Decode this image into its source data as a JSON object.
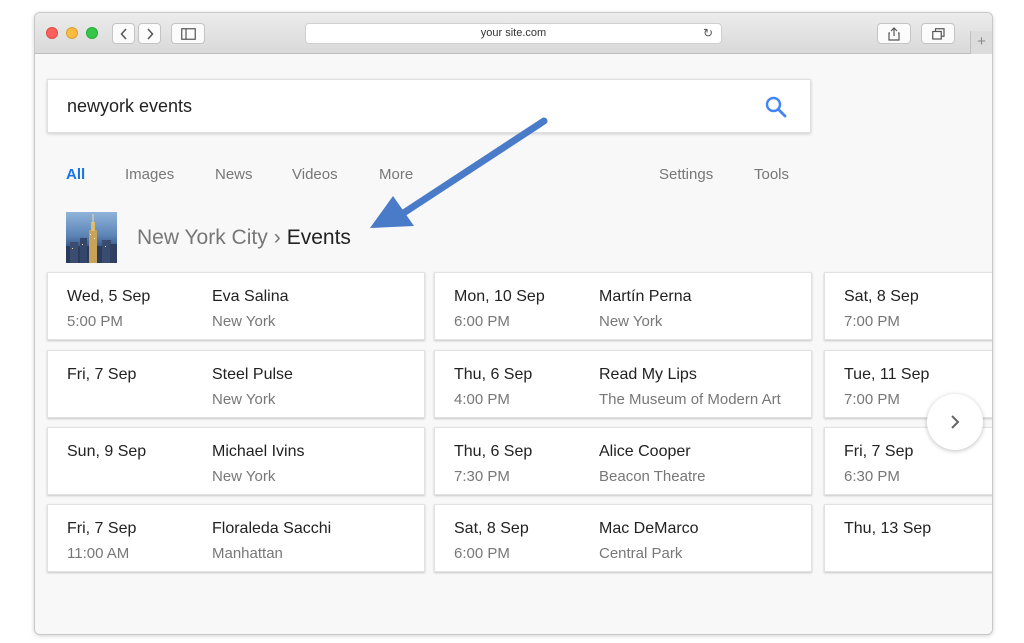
{
  "browser": {
    "url": "your site.com"
  },
  "search": {
    "query": "newyork events"
  },
  "tabs": [
    {
      "label": "All",
      "active": true
    },
    {
      "label": "Images"
    },
    {
      "label": "News"
    },
    {
      "label": "Videos"
    },
    {
      "label": "More"
    },
    {
      "label": "Settings"
    },
    {
      "label": "Tools"
    }
  ],
  "breadcrumb": {
    "parent": "New York City",
    "separator": "›",
    "current": "Events"
  },
  "events": {
    "col1": [
      {
        "date": "Wed, 5 Sep",
        "time": "5:00 PM",
        "name": "Eva Salina",
        "place": "New York"
      },
      {
        "date": "Fri, 7 Sep",
        "time": "",
        "name": "Steel Pulse",
        "place": "New York"
      },
      {
        "date": "Sun, 9 Sep",
        "time": "",
        "name": "Michael Ivins",
        "place": "New York"
      },
      {
        "date": "Fri, 7 Sep",
        "time": "11:00 AM",
        "name": "Floraleda Sacchi",
        "place": "Manhattan"
      }
    ],
    "col2": [
      {
        "date": "Mon, 10 Sep",
        "time": "6:00 PM",
        "name": "Martín Perna",
        "place": "New York"
      },
      {
        "date": "Thu, 6 Sep",
        "time": "4:00 PM",
        "name": "Read My Lips",
        "place": "The Museum of Modern Art"
      },
      {
        "date": "Thu, 6 Sep",
        "time": "7:30 PM",
        "name": "Alice Cooper",
        "place": "Beacon Theatre"
      },
      {
        "date": "Sat, 8 Sep",
        "time": "6:00 PM",
        "name": "Mac DeMarco",
        "place": "Central Park"
      }
    ],
    "col3": [
      {
        "date": "Sat, 8 Sep",
        "time": "7:00 PM"
      },
      {
        "date": "Tue, 11 Sep",
        "time": "7:00 PM"
      },
      {
        "date": "Fri, 7 Sep",
        "time": "6:30 PM"
      },
      {
        "date": "Thu, 13 Sep",
        "time": ""
      }
    ]
  },
  "colors": {
    "accent": "#1a73e8",
    "arrow": "#4a7bc8"
  }
}
